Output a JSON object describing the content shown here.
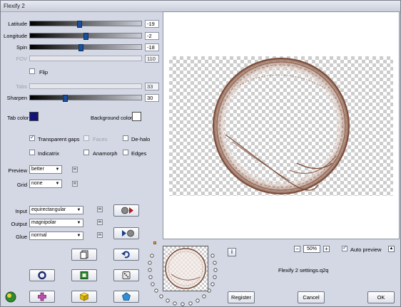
{
  "window": {
    "title": "Flexify 2"
  },
  "sliders": [
    {
      "label": "Latitude",
      "value": "-19",
      "pos": 0.44,
      "disabled": false
    },
    {
      "label": "Longitude",
      "value": "-2",
      "pos": 0.5,
      "disabled": false
    },
    {
      "label": "Spin",
      "value": "-18",
      "pos": 0.45,
      "disabled": false
    },
    {
      "label": "FOV",
      "value": "110",
      "pos": null,
      "disabled": true
    }
  ],
  "flip": {
    "label": "Flip",
    "checked": false
  },
  "tabs": {
    "label": "Tabs",
    "value": "33"
  },
  "sharpen": {
    "label": "Sharpen",
    "value": "30",
    "pos": 0.31
  },
  "tab_color": {
    "label": "Tab color",
    "color": "#12127a"
  },
  "background_color": {
    "label": "Background color",
    "color": "#ffffff"
  },
  "options": {
    "transparent_gaps": {
      "label": "Transparent gaps",
      "checked": true
    },
    "faces": {
      "label": "Faces",
      "checked": false,
      "disabled": true
    },
    "de_halo": {
      "label": "De-halo",
      "checked": false
    },
    "indicatrix": {
      "label": "Indicatrix",
      "checked": false
    },
    "anamorph": {
      "label": "Anamorph",
      "checked": false
    },
    "edges": {
      "label": "Edges",
      "checked": false
    }
  },
  "preview_quality": {
    "label": "Preview",
    "value": "better"
  },
  "grid": {
    "label": "Grid",
    "value": "none"
  },
  "input": {
    "label": "Input",
    "value": "equirectangular"
  },
  "output": {
    "label": "Output",
    "value": "magnipolar"
  },
  "glue": {
    "label": "Glue",
    "value": "normal"
  },
  "zoom": {
    "minus": "−",
    "value": "50%",
    "plus": "+"
  },
  "auto_preview": {
    "label": "Auto preview",
    "checked": true
  },
  "settings_file": "Flexify 2 settings.q2q",
  "buttons": {
    "register": "Register",
    "cancel": "Cancel",
    "ok": "OK"
  },
  "mini_label": "m",
  "info_label": "i",
  "colors": {
    "accent": "#1a4f9c",
    "panel": "#d4d8e4",
    "globe": "#8a5a46"
  }
}
